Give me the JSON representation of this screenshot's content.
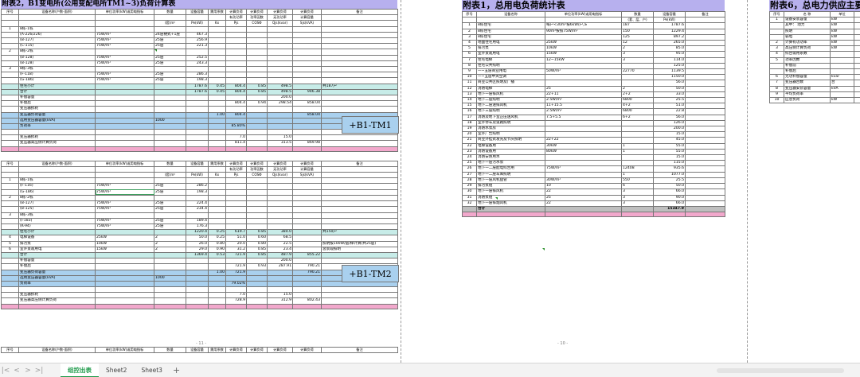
{
  "left": {
    "title": "附表2，B1变电所(公用变配电所TM1~3)负荷计算表",
    "header": [
      "序号",
      "设备名称(户数-面积)",
      "单位功率(kW)或用电指标",
      "数量",
      "设备容量",
      "需用系数",
      "计算负荷",
      "计算负荷",
      "计算负荷",
      "计算负荷",
      "备注"
    ],
    "header2": [
      "",
      "",
      "",
      "",
      "",
      "",
      "有功功率",
      "功率因数",
      "无功功率",
      "计算容量",
      ""
    ],
    "units": [
      "",
      "",
      "",
      "(套)m²",
      "Pe(kW)",
      "Kx",
      "Pjs",
      "COSΦ",
      "Qjs(kvar)",
      "Sjs(kVA)",
      ""
    ],
    "rows1": [
      [
        "1",
        "8栋-1栋",
        "",
        "",
        "",
        "",
        "",
        "",
        "",
        "",
        ""
      ],
      [
        "",
        "(A-226/226)",
        "75W/m²",
        "24层裙式+1层",
        "467.3",
        "",
        "",
        "",
        "",
        "",
        ""
      ],
      [
        "",
        "(B-127)",
        "75W/m²",
        "25层",
        "256.9",
        "",
        "",
        "",
        "",
        "",
        ""
      ],
      [
        "",
        "(C-115)",
        "75W/m²",
        "25层",
        "221.3",
        "",
        "",
        "",
        "",
        "",
        ""
      ],
      [
        "2",
        "8栋-2栋",
        "",
        "",
        "",
        "",
        "",
        "",
        "",
        "",
        ""
      ],
      [
        "",
        "(B-128)",
        "75W/m²",
        "25层",
        "252.5",
        "",
        "",
        "",
        "",
        "",
        ""
      ],
      [
        "",
        "(B-128)",
        "75W/m²",
        "25层",
        "243.3",
        "",
        "",
        "",
        "",
        "",
        ""
      ],
      [
        "3",
        "8栋-3栋",
        "",
        "",
        "",
        "",
        "",
        "",
        "",
        "",
        ""
      ],
      [
        "",
        "(F-118)",
        "75W/m²",
        "25层",
        "286.3",
        "",
        "",
        "",
        "",
        "",
        ""
      ],
      [
        "",
        "(G-186)",
        "75W/m²",
        "25层",
        "198.3",
        "",
        "",
        "",
        "",
        "",
        ""
      ],
      [
        "",
        "住宅小计",
        "",
        "",
        "1787.6",
        "0.45",
        "804.4",
        "0.85",
        "498.5",
        "",
        "共187户"
      ],
      [
        "",
        "合计",
        "",
        "",
        "1787.6",
        "0.45",
        "804.4",
        "0.85",
        "498.5",
        "946.38",
        ""
      ],
      [
        "",
        "补偿容量",
        "",
        "",
        "",
        "",
        "",
        "",
        "200.0",
        "",
        ""
      ],
      [
        "",
        "补偿后",
        "",
        "",
        "",
        "",
        "804.4",
        "0.94",
        "298.54",
        "858.04",
        ""
      ],
      [
        "",
        "变压器损耗",
        "",
        "",
        "",
        "",
        "",
        "",
        "",
        "",
        ""
      ],
      [
        "",
        "变压器负荷容量",
        "",
        "",
        "",
        "1.00",
        "804.4",
        "",
        "",
        "858.04",
        ""
      ],
      [
        "",
        "选用变压器容量(kVA)",
        "",
        "1000",
        "",
        "",
        "",
        "",
        "",
        "",
        ""
      ],
      [
        "",
        "负荷率",
        "",
        "",
        "",
        "",
        "85.80%",
        "",
        "",
        "",
        ""
      ],
      [
        "",
        "",
        "",
        "",
        "",
        "",
        "",
        "",
        "",
        "",
        ""
      ],
      [
        "",
        "变压器损耗",
        "",
        "",
        "",
        "",
        "7.0",
        "",
        "15.0",
        "",
        ""
      ],
      [
        "",
        "变压器高压侧计算负荷",
        "",
        "",
        "",
        "",
        "811.4",
        "",
        "313.5",
        "869.98",
        ""
      ]
    ],
    "tag1": "+B1-TM1",
    "rows2": [
      [
        "1",
        "8栋-1栋",
        "",
        "",
        "",
        "",
        "",
        "",
        "",
        "",
        ""
      ],
      [
        "",
        "(F-116)",
        "75W/m²",
        "25层",
        "286.2",
        "",
        "",
        "",
        "",
        "",
        ""
      ],
      [
        "",
        "(G-186)",
        "75W/m²",
        "25层",
        "198.3",
        "",
        "",
        "",
        "",
        "",
        ""
      ],
      [
        "2",
        "8栋-2栋",
        "",
        "",
        "",
        "",
        "",
        "",
        "",
        "",
        ""
      ],
      [
        "",
        "(B-127)",
        "75W/m²",
        "25层",
        "224.4",
        "",
        "",
        "",
        "",
        "",
        ""
      ],
      [
        "",
        "(B-125)",
        "75W/m²",
        "25层",
        "234.4",
        "",
        "",
        "",
        "",
        "",
        ""
      ],
      [
        "3",
        "8栋-3栋",
        "",
        "",
        "",
        "",
        "",
        "",
        "",
        "",
        ""
      ],
      [
        "",
        "(I-183)",
        "75W/m²",
        "25层",
        "189.4",
        "",
        "",
        "",
        "",
        "",
        ""
      ],
      [
        "",
        "(K-94)",
        "75W/m²",
        "25层",
        "176.3",
        "",
        "",
        "",
        "",
        "",
        ""
      ],
      [
        "",
        "住宅小计",
        "",
        "",
        "1220.4",
        "0.25",
        "619.7",
        "0.85",
        "384.0",
        "",
        "共150户"
      ],
      [
        "4",
        "电梯设备",
        "25kW",
        "2",
        "50.0",
        "0.25",
        "51.0",
        "0.60",
        "68.5",
        "",
        ""
      ],
      [
        "5",
        "排污泵",
        "10kW",
        "2",
        "26.0",
        "0.80",
        "20.0",
        "0.80",
        "22.5",
        "",
        "照明按100W/层/梯计算(共25层)"
      ],
      [
        "6",
        "室外景观用电",
        "15kW",
        "2",
        "29.0",
        "0.90",
        "31.2",
        "0.85",
        "23.4",
        "",
        "含景观照明"
      ],
      [
        "",
        "合计",
        "",
        "",
        "1369.4",
        "0.53",
        "721.9",
        "0.85",
        "487.9",
        "855.22",
        ""
      ],
      [
        "",
        "补偿容量",
        "",
        "",
        "",
        "",
        "",
        "",
        "200.0",
        "",
        ""
      ],
      [
        "",
        "补偿后",
        "",
        "",
        "",
        "",
        "721.9",
        "0.93",
        "287.91",
        "790.21",
        ""
      ],
      [
        "",
        "变压器负荷容量",
        "",
        "",
        "",
        "1.00",
        "721.9",
        "",
        "",
        "790.21",
        ""
      ],
      [
        "",
        "选用变压器容量(kVA)",
        "",
        "1000",
        "",
        "",
        "",
        "",
        "",
        "",
        ""
      ],
      [
        "",
        "负荷率",
        "",
        "",
        "",
        "",
        "79.02%",
        "",
        "",
        "",
        ""
      ],
      [
        "",
        "",
        "",
        "",
        "",
        "",
        "",
        "",
        "",
        "",
        ""
      ],
      [
        "",
        "变压器损耗",
        "",
        "",
        "",
        "",
        "7.0",
        "",
        "15.0",
        "",
        ""
      ],
      [
        "",
        "变压器高压侧计算负荷",
        "",
        "",
        "",
        "",
        "728.9",
        "",
        "312.9",
        "802.43",
        ""
      ]
    ],
    "tag2": "+B1-TM2",
    "page": "- 11 -"
  },
  "right": {
    "title": "附表1，总用电负荷统计表",
    "header": [
      "序号",
      "设备名称",
      "单位功率(kW)或用电指标",
      "数量",
      "设备容量",
      "备注"
    ],
    "units": [
      "",
      "",
      "",
      "(套、层、户)",
      "Pe(kW)",
      ""
    ],
    "rows": [
      [
        "1",
        "8栋住宅",
        "每户<30m²按6kW/户,≥",
        "187",
        "1787.6",
        ""
      ],
      [
        "2",
        "8栋住宅",
        "90m²按照75W/m²",
        "150",
        "1229.4",
        ""
      ],
      [
        "3",
        "8栋住宅",
        "",
        "125",
        "897.2",
        ""
      ],
      [
        "4",
        "地面住宅用电",
        "25kW",
        "12",
        "265.0",
        ""
      ],
      [
        "5",
        "排污泵",
        "10kW",
        "2",
        "85.0",
        ""
      ],
      [
        "6",
        "室外景观用电",
        "15kW",
        "3",
        "95.0",
        ""
      ],
      [
        "7",
        "住宅电梯",
        "12~15kW",
        "3",
        "114.0",
        ""
      ],
      [
        "8",
        "住宅公共照明",
        "",
        "",
        "125.0",
        ""
      ],
      [
        "9",
        "一~五层商业用电",
        "50W/m²",
        "22770",
        "1139.5",
        ""
      ],
      [
        "10",
        "一~五层中央空调",
        "",
        "",
        "1150.0",
        ""
      ],
      [
        "11",
        "商业公共区照明及广播",
        "",
        "",
        "56.0",
        ""
      ],
      [
        "12",
        "消防电梯",
        "25",
        "2",
        "50.0",
        ""
      ],
      [
        "13",
        "地下一层排风机",
        "22+11",
        "2+2",
        "33.0",
        ""
      ],
      [
        "14",
        "地下二层照明",
        "2.5W/m²",
        "6800",
        "25.5",
        ""
      ],
      [
        "15",
        "地下二层送排风机",
        "11+15.5",
        "4+2",
        "51.0",
        ""
      ],
      [
        "16",
        "地下三层照明",
        "2.5W/m²",
        "6800",
        "22.8",
        ""
      ],
      [
        "17",
        "消防及地下室正压送风机",
        "7.5+5.5",
        "6+2",
        "56.0",
        ""
      ],
      [
        "18",
        "室外停车及道路照明",
        "",
        "",
        "126.0",
        ""
      ],
      [
        "19",
        "消防水泵房",
        "",
        "",
        "200.0",
        ""
      ],
      [
        "20",
        "室外广告照明",
        "",
        "",
        "15.0",
        ""
      ],
      [
        "21",
        "商业外挂式发光及节庆照明",
        "22+22",
        "",
        "45.0",
        ""
      ],
      [
        "22",
        "电梯设备用",
        "30kW",
        "1",
        "55.0",
        ""
      ],
      [
        "23",
        "消防设备用",
        "80kW",
        "1",
        "55.0",
        ""
      ],
      [
        "24",
        "消防安防用水",
        "",
        "",
        "15.0",
        ""
      ],
      [
        "25",
        "地下一层污水泵",
        "",
        "",
        "115.0",
        ""
      ],
      [
        "26",
        "地下一二层配电综合用",
        "75W/m²",
        "12408",
        "935.6",
        ""
      ],
      [
        "27",
        "地下一二层车库照明",
        "",
        "1",
        "1077.0",
        ""
      ],
      [
        "28",
        "地下一层风机盘管",
        "30W/m²",
        "550",
        "25.5",
        ""
      ],
      [
        "29",
        "排污泵组",
        "10",
        "6",
        "50.0",
        ""
      ],
      [
        "30",
        "地下一层排风机",
        "22",
        "3",
        "66.0",
        ""
      ],
      [
        "31",
        "消防泵组",
        "25",
        "3",
        "90.0",
        ""
      ],
      [
        "32",
        "地下一层排烟风机",
        "22",
        "3",
        "66.0",
        ""
      ],
      [
        "",
        "合计",
        "",
        "",
        "15347.9",
        ""
      ]
    ],
    "page": "- 10 -"
  },
  "far": {
    "title": "附表6，总电力供应主要指",
    "header": [
      "序号",
      "名 称",
      "单位"
    ],
    "rows": [
      [
        "1",
        "设备安装容量",
        "kW"
      ],
      [
        "",
        "其中：   动力",
        "kW"
      ],
      [
        "",
        "照明",
        "kW"
      ],
      [
        "",
        "弱电",
        "kW"
      ],
      [
        "2",
        "计算有功功率",
        "kW"
      ],
      [
        "3",
        "高压侧计算负荷",
        "kW"
      ],
      [
        "4",
        "综合需用系数",
        ""
      ],
      [
        "5",
        "功率因数",
        ""
      ],
      [
        "",
        "补偿前",
        ""
      ],
      [
        "",
        "补偿后",
        ""
      ],
      [
        "6",
        "无功补偿容量",
        "kvar"
      ],
      [
        "7",
        "变压器台数",
        "台"
      ],
      [
        "8",
        "变压器安装容量",
        "kVA"
      ],
      [
        "9",
        "平均负荷率",
        ""
      ],
      [
        "10",
        "应急负荷",
        "kW"
      ]
    ]
  },
  "tabs": [
    "组控出表",
    "Sheet2",
    "Sheet3"
  ],
  "active_tab": "组控出表",
  "nav": {
    "first": "|<",
    "prev": "<",
    "next": ">",
    "last": ">|",
    "add": "+"
  },
  "colors": {
    "header": "#a9d0ee",
    "subtotal": "#c7ece8",
    "separator": "#f2a8cc",
    "total": "#bfbfbf",
    "active_tab": "#1e9a4a"
  }
}
